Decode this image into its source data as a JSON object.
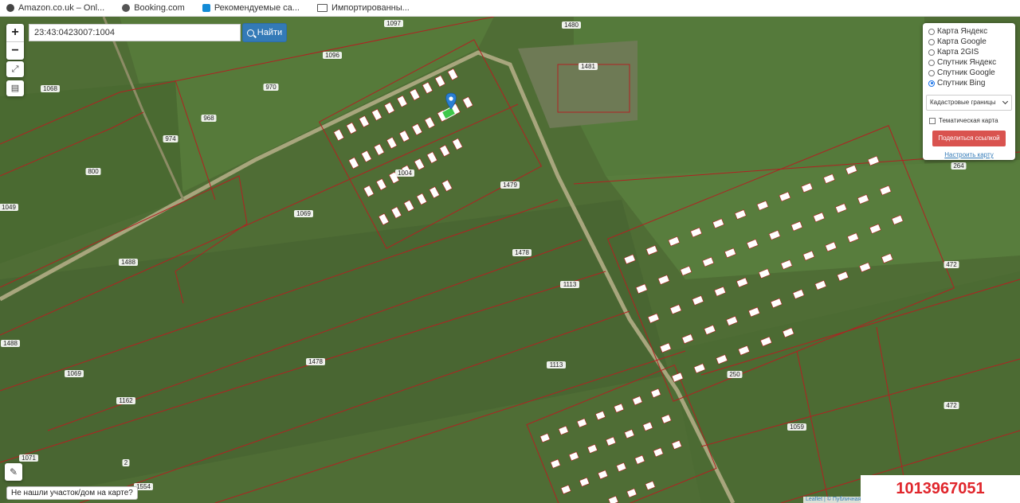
{
  "bookmarks": [
    {
      "label": "Amazon.co.uk – Onl...",
      "icon": "amazon-icon"
    },
    {
      "label": "Booking.com",
      "icon": "booking-icon"
    },
    {
      "label": "Рекомендуемые са...",
      "icon": "bing-icon"
    },
    {
      "label": "Импортированны...",
      "icon": "folder-icon"
    }
  ],
  "search": {
    "value": "23:43:0423007:1004"
  },
  "find_button": "Найти",
  "zoom": {
    "in": "+",
    "out": "−"
  },
  "layers": {
    "options": [
      "Карта Яндекс",
      "Карта Google",
      "Карта 2GIS",
      "Спутник Яндекс",
      "Спутник Google",
      "Спутник Bing"
    ],
    "selected": "Спутник Bing",
    "overlay_select": "Кадастровые границы",
    "thematic_label": "Тематическая карта",
    "share_button": "Поделиться ссылкой",
    "setup_link": "Настроить карту"
  },
  "not_found_button": "Не нашли участок/дом на карте?",
  "listing_id": "1013967051",
  "attribution": "Leaflet | © Публичная ...",
  "plot_labels": [
    "1097",
    "1480",
    "1096",
    "970",
    "1068",
    "968",
    "974",
    "1481",
    "800",
    "1049",
    "1069",
    "1479",
    "1488",
    "1478",
    "1113",
    "1488",
    "1069",
    "1478",
    "1162",
    "1113",
    "1071",
    "2",
    "1554",
    "1059",
    "472",
    "250",
    "264",
    "472",
    "1004"
  ]
}
